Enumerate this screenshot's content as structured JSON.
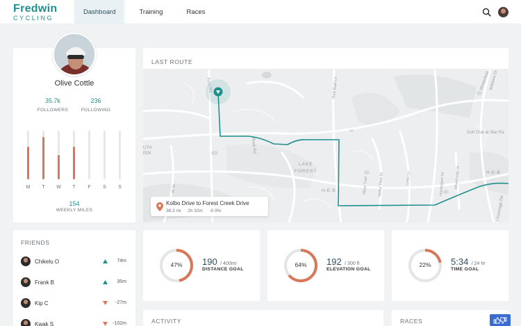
{
  "app": {
    "logo_main": "Fredwin",
    "logo_sub": "CYCLING",
    "nav": [
      {
        "label": "Dashboard",
        "active": true
      },
      {
        "label": "Training",
        "active": false
      },
      {
        "label": "Races",
        "active": false
      }
    ],
    "icons": {
      "search": "search-icon",
      "avatar": "user-avatar"
    }
  },
  "profile": {
    "name": "Olive Cottle",
    "followers_value": "35.7k",
    "followers_label": "FOLLOWERS",
    "following_value": "236",
    "following_label": "FOLLOWING",
    "weekly": [
      {
        "day": "M",
        "fraction": 0.67
      },
      {
        "day": "T",
        "fraction": 0.87
      },
      {
        "day": "W",
        "fraction": 0.5
      },
      {
        "day": "T",
        "fraction": 0.67
      },
      {
        "day": "F",
        "fraction": 0
      },
      {
        "day": "S",
        "fraction": 0
      },
      {
        "day": "S",
        "fraction": 0
      }
    ],
    "weekly_miles_value": "154",
    "weekly_miles_label": "WEEKLY MILES"
  },
  "route": {
    "title": "LAST ROUTE",
    "name": "Kolbo Drive to Forest Creek Drive",
    "distance": "38.3 mi",
    "duration": "2h 32m",
    "grade": "-0.9%",
    "map_labels": {
      "lake": "LAKE",
      "forest": "FOREST",
      "heb1": "H-E-B",
      "heb2": "H-E-B",
      "golf": "Golf Club at Star Ra",
      "fordrd": "Ford Rd",
      "redbud": "Red Bud Ln",
      "winterfield": "Winterfield",
      "wildsea": "Wildsea Dr",
      "rusk": "Rusk Rd",
      "silver": "Silver Trail",
      "valley": "Valley View Dr",
      "links": "Links Ln",
      "huntington": "Huntington Trl",
      "meadowild": "Meadowild Dr",
      "frontage": "I Frontage Rd",
      "ekdr": "ek Dr",
      "ek": "EEK",
      "uth": "UTH"
    },
    "accent": "#1f8f8e"
  },
  "friends": {
    "title": "FRIENDS",
    "items": [
      {
        "name": "Chikelu O",
        "trend": "up",
        "value": "74m"
      },
      {
        "name": "Frank B",
        "trend": "up",
        "value": "35m"
      },
      {
        "name": "Kip C",
        "trend": "down",
        "value": "-27m"
      },
      {
        "name": "Kwak S",
        "trend": "down",
        "value": "-102m"
      }
    ]
  },
  "goals": [
    {
      "percent_label": "47%",
      "fraction": 0.47,
      "value": "190",
      "unit": "/ 400mi",
      "label": "DISTANCE GOAL"
    },
    {
      "percent_label": "64%",
      "fraction": 0.64,
      "value": "192",
      "unit": "/ 300 ft",
      "label": "ELEVATION GOAL"
    },
    {
      "percent_label": "22%",
      "fraction": 0.22,
      "value": "5:34",
      "unit": "/ 24 hr",
      "label": "TIME GOAL"
    }
  ],
  "activity": {
    "title": "ACTIVITY"
  },
  "races": {
    "title": "RACES"
  },
  "colors": {
    "brand": "#1f8f8e",
    "accent": "#d8775a",
    "ring_track": "#e3e6e8",
    "trend_up": "#1f8f8e",
    "trend_down": "#d8775a"
  }
}
